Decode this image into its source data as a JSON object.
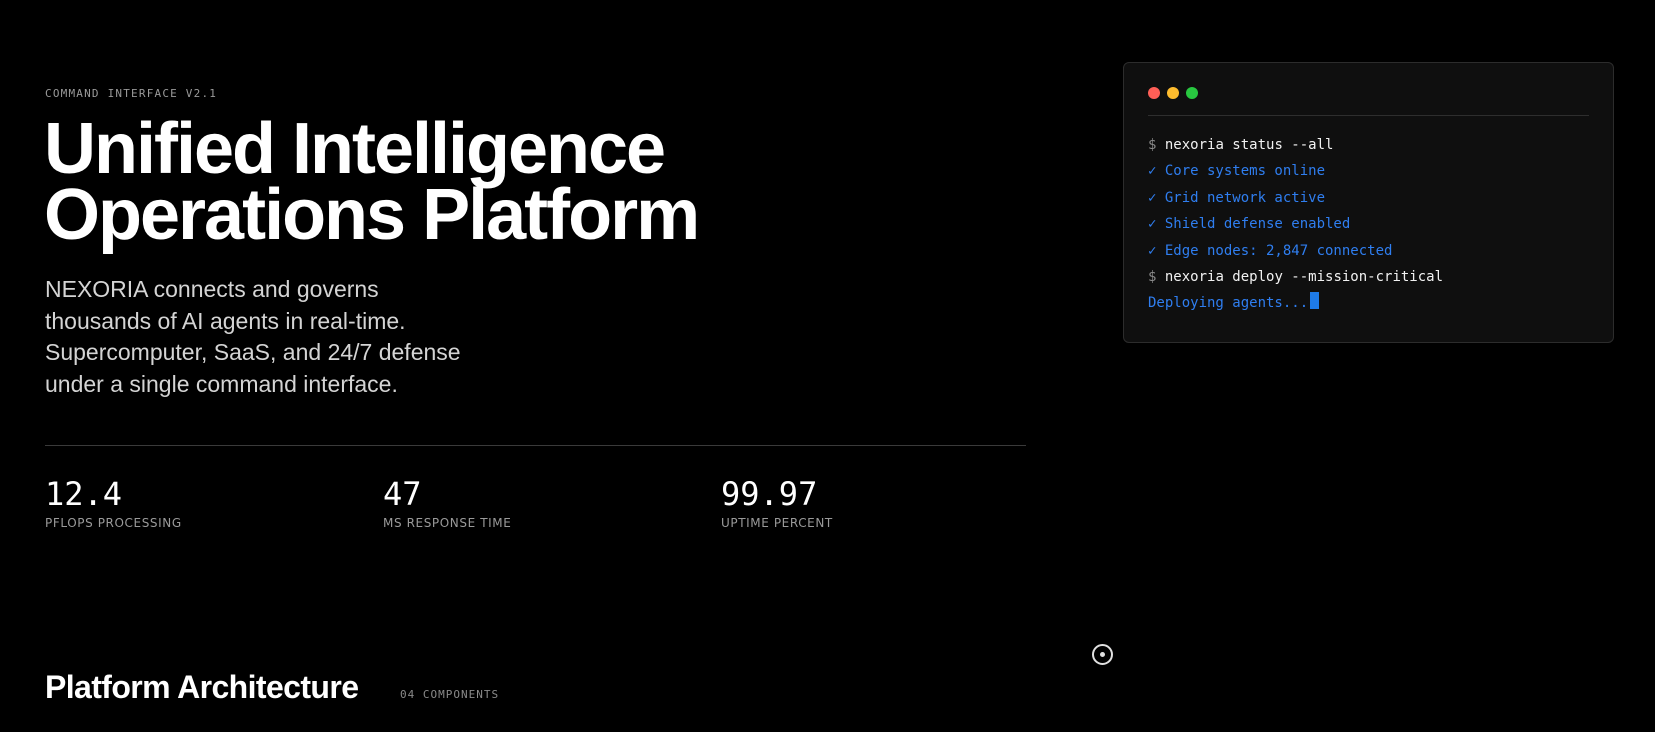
{
  "hero": {
    "eyebrow": "COMMAND INTERFACE V2.1",
    "title_line_1": "Unified Intelligence",
    "title_line_2": "Operations Platform",
    "description_lines": [
      "NEXORIA connects and governs",
      "thousands of AI agents in real-time.",
      "Supercomputer, SaaS, and 24/7 defense",
      "under a single command interface."
    ]
  },
  "stats": [
    {
      "value": "12.4",
      "label": "PFLOPS PROCESSING"
    },
    {
      "value": "47",
      "label": "MS RESPONSE TIME"
    },
    {
      "value": "99.97",
      "label": "UPTIME PERCENT"
    }
  ],
  "terminal": {
    "window_controls": [
      {
        "icon": "close-dot-icon",
        "color": "#ff5f57"
      },
      {
        "icon": "minimize-dot-icon",
        "color": "#febc2e"
      },
      {
        "icon": "maximize-dot-icon",
        "color": "#28c840"
      }
    ],
    "lines": [
      {
        "kind": "command",
        "prompt": "$",
        "text": "nexoria status --all"
      },
      {
        "kind": "output",
        "text": "✓ Core systems online"
      },
      {
        "kind": "output",
        "text": "✓ Grid network active"
      },
      {
        "kind": "output",
        "text": "✓ Shield defense enabled"
      },
      {
        "kind": "output",
        "text": "✓ Edge nodes: 2,847 connected"
      },
      {
        "kind": "command",
        "prompt": "$",
        "text": "nexoria deploy --mission-critical"
      },
      {
        "kind": "progress",
        "text": "Deploying agents..."
      }
    ]
  },
  "floating_icon": "scroll-indicator-icon",
  "section": {
    "title": "Platform Architecture",
    "meta": "04 COMPONENTS"
  },
  "colors": {
    "background": "#000000",
    "accent": "#2f7ef0",
    "muted_text": "#9a9a9a",
    "terminal_bg": "#0f0f0f"
  }
}
